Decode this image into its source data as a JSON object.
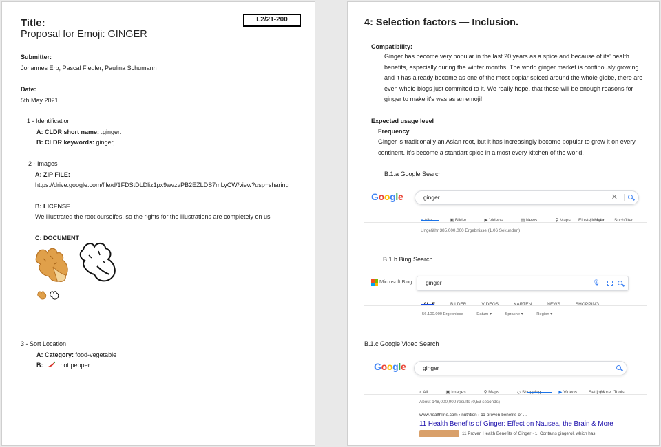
{
  "page1": {
    "doc_id": "L2/21-200",
    "title_label": "Title:",
    "title": "Proposal for Emoji: GINGER",
    "submitter_label": "Submitter:",
    "submitter": "Johannes Erb, Pascal Fiedler, Paulina Schumann",
    "date_label": "Date:",
    "date": "5th May 2021",
    "identification": {
      "heading": "1 - Identification",
      "a_label": "A: CLDR short name:",
      "a_value": ":ginger:",
      "b_label": "B: CLDR keywords:",
      "b_value": "ginger,"
    },
    "images": {
      "heading": "2 - Images",
      "a_label": "A: ZIP FILE:",
      "zip_url": "https://drive.google.com/file/d/1FDStDLDliz1px9wvzvPB2EZLDS7mLyCW/view?usp=sharing",
      "b_label": "B: LICENSE",
      "license": "We illustrated the root ourselfes, so the rights for the illustrations are completely on us",
      "c_label": "C: DOCUMENT"
    },
    "sort": {
      "heading": "3 - Sort Location",
      "a_label": "A: Category:",
      "a_value": "food-vegetable",
      "b_label": "B:",
      "b_value": "hot pepper"
    }
  },
  "page2": {
    "heading": "4: Selection factors — Inclusion.",
    "compat_label": "Compatibility:",
    "compat_text": "Ginger has become very popular in the last 20 years as a spice and because of its' health benefits, especially during the winter months. The world ginger market is continously growing and it has already become as one of the most poplar spiced around the whole globe, there are even whole blogs just commited to it. We really hope, that these will be enough reasons for ginger to make it's was as an emoji!",
    "usage_label": "Expected usage level",
    "freq_label": "Frequency",
    "freq_text": "Ginger is traditionally an Asian root, but it has increasingly become popular to grow it on every continent. It's become a standart spice in almost every kitchen of the world.",
    "google": {
      "caption": "B.1.a Google Search",
      "logo": [
        "G",
        "o",
        "o",
        "g",
        "l",
        "e"
      ],
      "query": "ginger",
      "tabs": [
        "Alle",
        "Bilder",
        "Videos",
        "News",
        "Maps",
        "Mehr"
      ],
      "tools": [
        "Einstellungen",
        "Suchfilter"
      ],
      "results": "Ungefähr 385.000.000 Ergebnisse (1,06 Sekunden)"
    },
    "bing": {
      "caption": "B.1.b Bing Search",
      "logo": "Microsoft Bing",
      "query": "ginger",
      "tabs": [
        "ALLE",
        "BILDER",
        "VIDEOS",
        "KARTEN",
        "NEWS",
        "SHOPPING"
      ],
      "results": "56.100.000 Ergebnisse",
      "filters": [
        "Datum",
        "Sprache",
        "Region"
      ]
    },
    "gvideo": {
      "caption": "B.1.c Google Video Search",
      "query": "ginger",
      "tabs": [
        "All",
        "Images",
        "Maps",
        "Shopping",
        "Videos",
        "More"
      ],
      "tools": [
        "Settings",
        "Tools"
      ],
      "results": "About 148,000,000 results (0,53 seconds)",
      "site": "www.healthline.com › nutrition › 11-proven-benefits-of-...",
      "link": "11 Health Benefits of Ginger: Effect on Nausea, the Brain & More",
      "snippet": "11 Proven Health Benefits of Ginger · 1. Contains gingerol, which has"
    },
    "colors": {
      "google_blue": "#4285f4",
      "google_red": "#ea4335",
      "google_yellow": "#fbbc05",
      "google_green": "#34a853",
      "link": "#1a0dab"
    }
  }
}
